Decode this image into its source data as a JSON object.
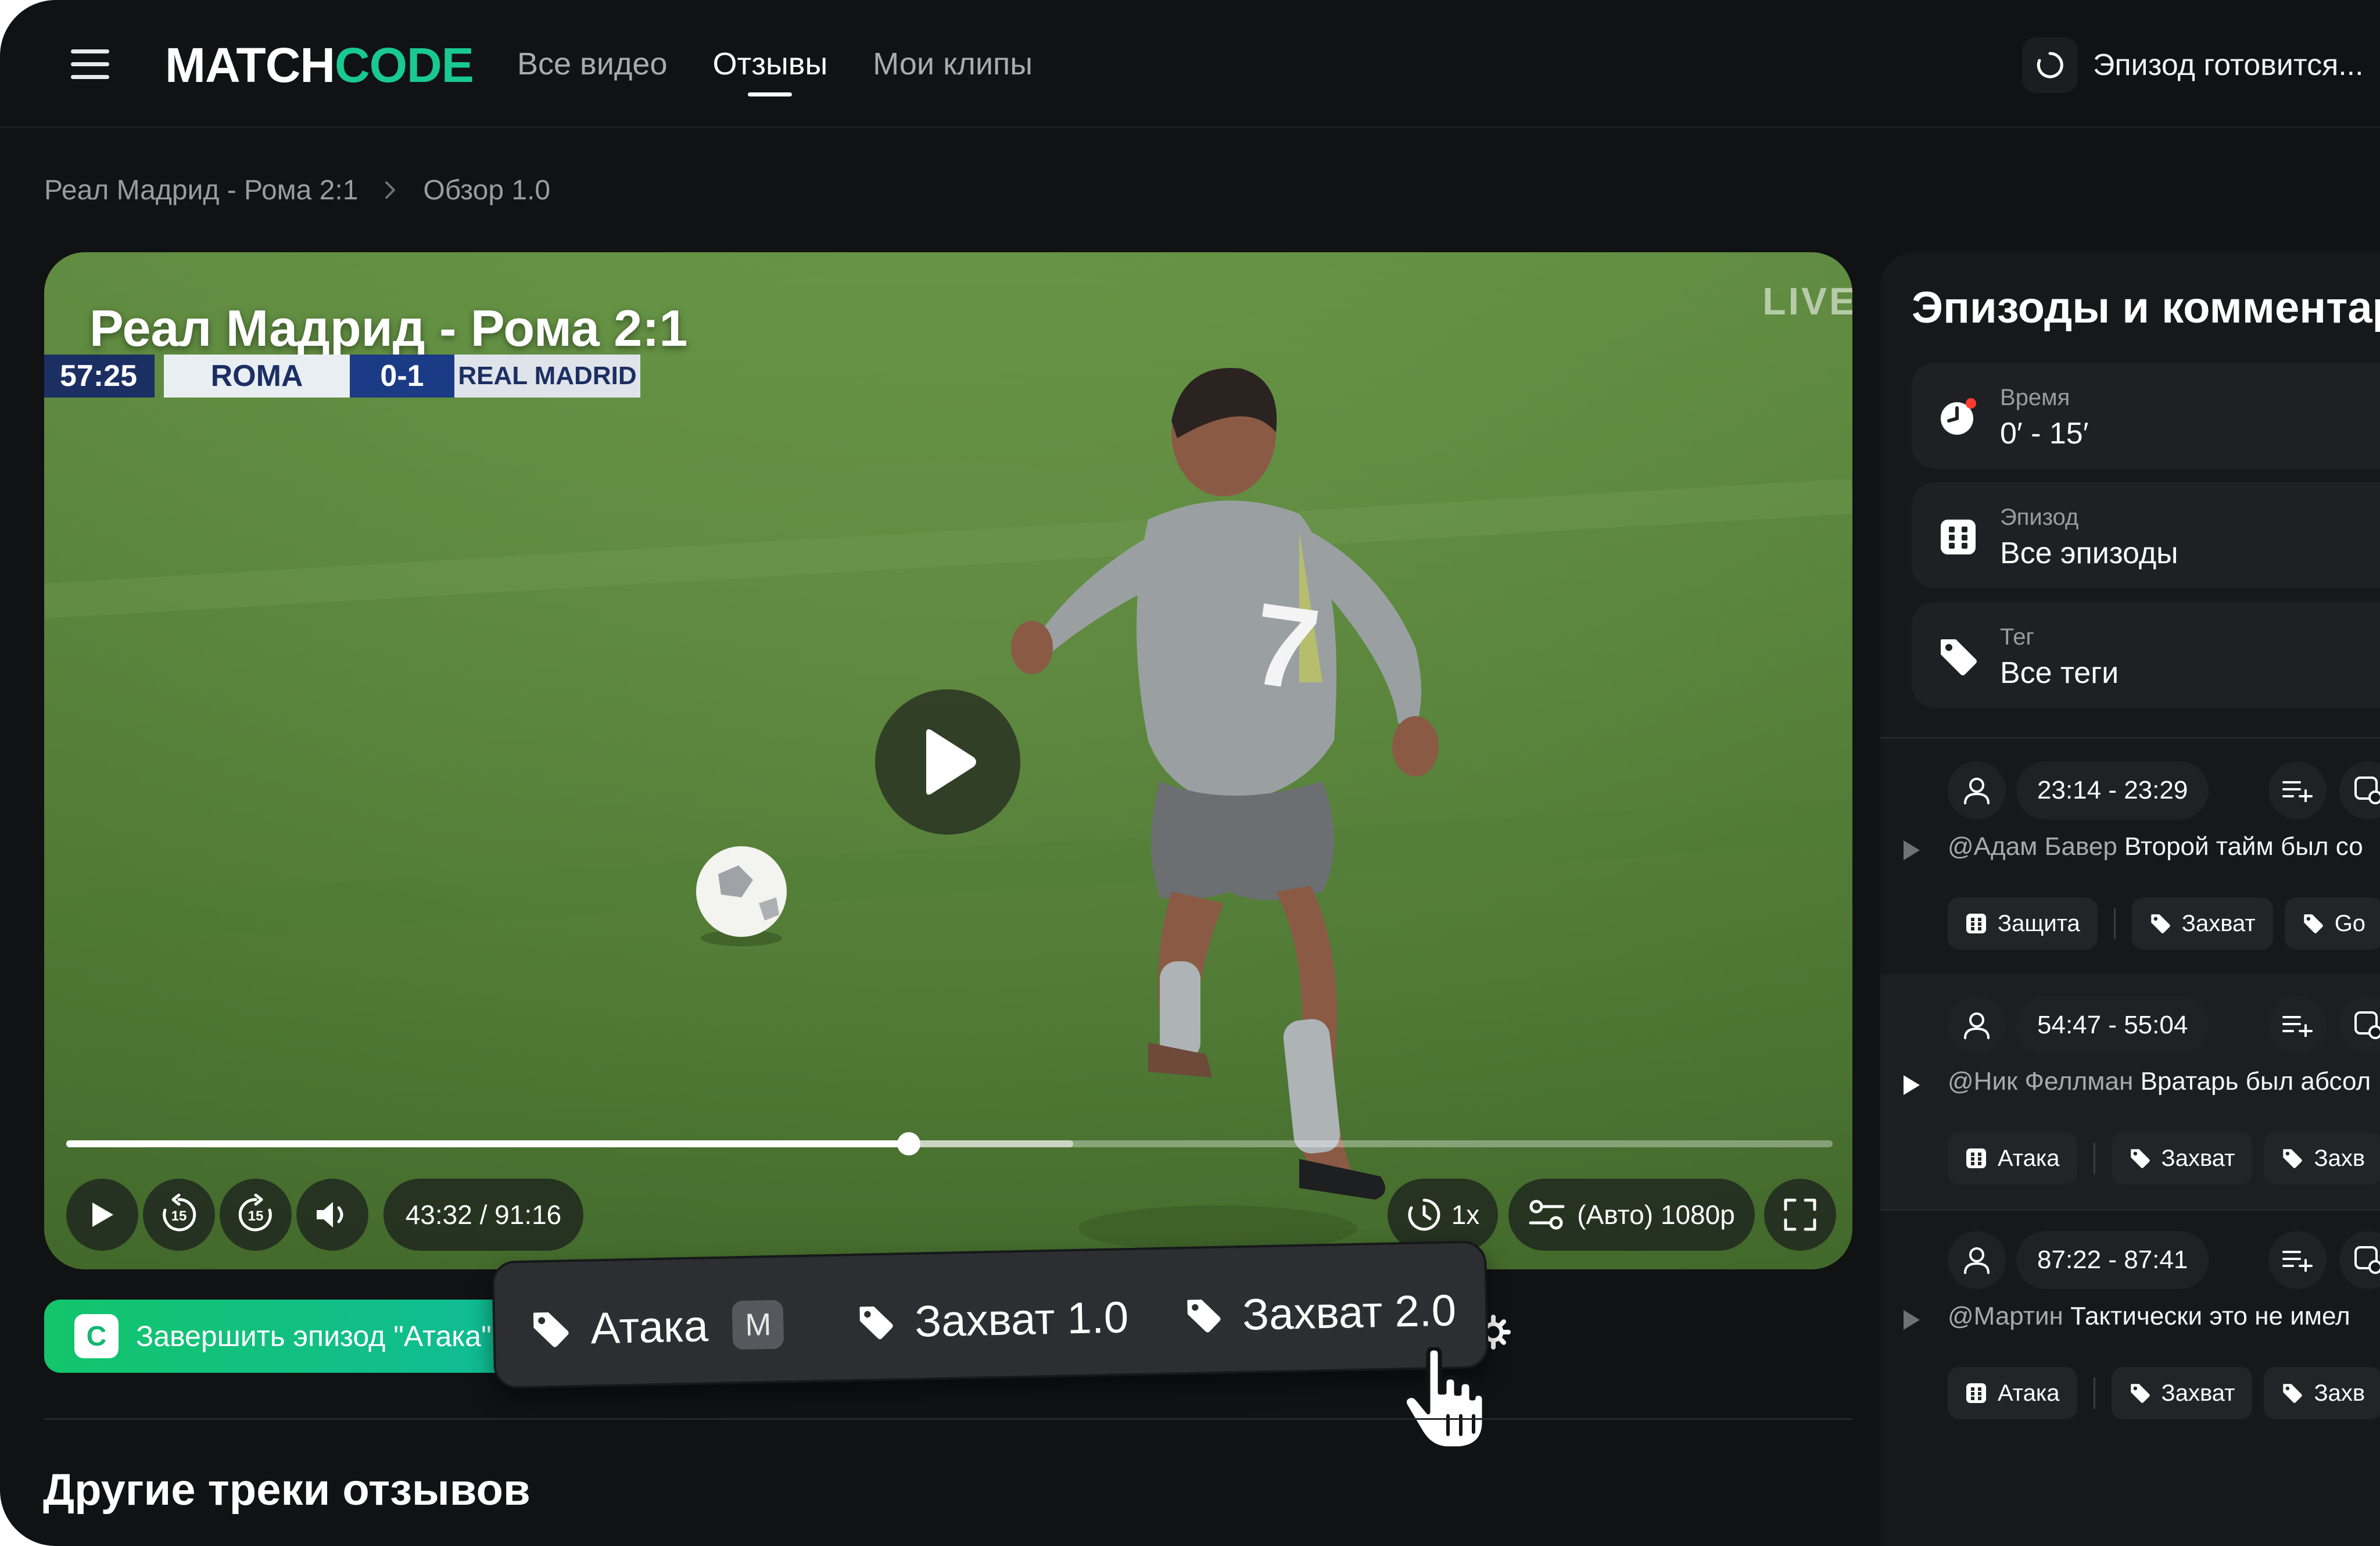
{
  "header": {
    "logo_part1": "MATCH",
    "logo_part2": "CODE",
    "nav": [
      {
        "label": "Все видео",
        "active": false
      },
      {
        "label": "Отзывы",
        "active": true
      },
      {
        "label": "Мои клипы",
        "active": false
      }
    ],
    "status_text": "Эпизод готовится..."
  },
  "breadcrumb": {
    "items": [
      "Реал Мадрид - Рома 2:1",
      "Обзор 1.0"
    ]
  },
  "video": {
    "title": "Реал Мадрид - Рома 2:1",
    "scoreboard": {
      "clock": "57:25",
      "home": "ROMA",
      "score": "0-1",
      "away": "REAL MADRID"
    },
    "live_label": "LIVE",
    "time_display": "43:32 / 91:16",
    "progress_fraction": 0.477,
    "buffered_fraction": 0.57,
    "speed_label": "1x",
    "quality_label": "(Авто) 1080p",
    "rewind_seconds": "15",
    "forward_seconds": "15"
  },
  "finish_episode": {
    "key": "C",
    "label": "Завершить эпизод \"Атака\""
  },
  "tag_popup": {
    "tags": [
      {
        "label": "Атака",
        "shortcut": "M"
      },
      {
        "label": "Захват 1.0",
        "shortcut": ""
      },
      {
        "label": "Захват 2.0",
        "shortcut": ""
      }
    ]
  },
  "other_tracks_title": "Другие треки отзывов",
  "panel": {
    "title": "Эпизоды и комментарии",
    "filters": [
      {
        "label": "Время",
        "value": "0′ - 15′",
        "icon": "clock-icon"
      },
      {
        "label": "Эпизод",
        "value": "Все эпизоды",
        "icon": "grid-icon"
      },
      {
        "label": "Тег",
        "value": "Все теги",
        "icon": "tag-icon"
      }
    ],
    "episodes": [
      {
        "time": "23:14 - 23:29",
        "mention": "@Адам Бавер",
        "comment": "Второй тайм был со",
        "episode_tag": "Защита",
        "tags": [
          "Захват",
          "Go"
        ],
        "active": false
      },
      {
        "time": "54:47 - 55:04",
        "mention": "@Ник Феллман",
        "comment": "Вратарь был абсол",
        "episode_tag": "Атака",
        "tags": [
          "Захват",
          "Захв"
        ],
        "active": true
      },
      {
        "time": "87:22 - 87:41",
        "mention": "@Мартин",
        "comment": "Тактически это не имел",
        "episode_tag": "Атака",
        "tags": [
          "Захват",
          "Захв"
        ],
        "active": false
      }
    ]
  },
  "colors": {
    "background": "#111214",
    "accent_green": "#19c98f",
    "finish_gradient_start": "#13c56b",
    "finish_gradient_end": "#0fb9a0",
    "panel": "#16181a"
  }
}
